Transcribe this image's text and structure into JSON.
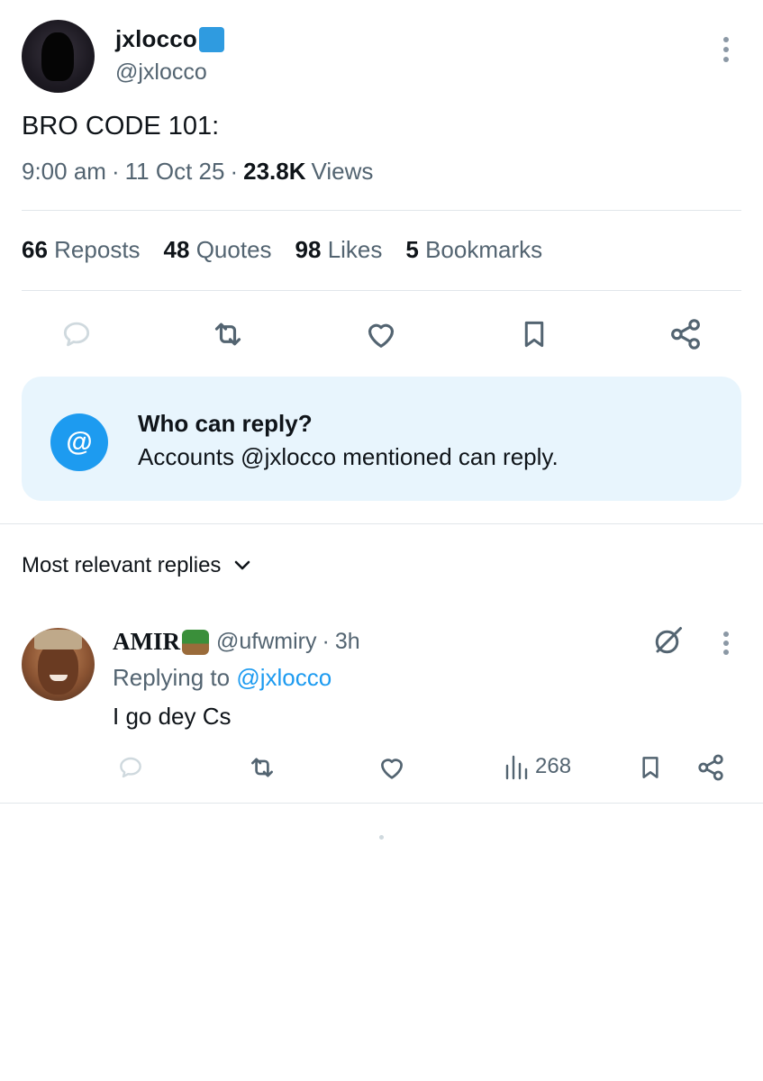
{
  "post": {
    "display_name": "jxlocco",
    "name_emoji": "🏄",
    "handle": "@jxlocco",
    "text": "BRO CODE 101:",
    "time": "9:00 am",
    "date": "11 Oct 25",
    "views_count": "23.8K",
    "views_label": "Views",
    "sep": "·"
  },
  "stats": {
    "reposts_count": "66",
    "reposts_label": "Reposts",
    "quotes_count": "48",
    "quotes_label": "Quotes",
    "likes_count": "98",
    "likes_label": "Likes",
    "bookmarks_count": "5",
    "bookmarks_label": "Bookmarks"
  },
  "reply_notice": {
    "title": "Who can reply?",
    "body": "Accounts @jxlocco mentioned can reply.",
    "icon_glyph": "@"
  },
  "replies_section": {
    "sort_label": "Most relevant replies"
  },
  "reply": {
    "display_name": "AMIR",
    "name_emoji": "🌴",
    "handle": "@ufwmiry",
    "sep": "·",
    "age": "3h",
    "replying_prefix": "Replying to",
    "replying_to": "@jxlocco",
    "text": "I go dey Cs",
    "views_count": "268"
  },
  "colors": {
    "text": "#0f1419",
    "muted": "#536471",
    "accent": "#1d9bf0",
    "notice_bg": "#e8f5fd",
    "divider": "#e1e6ea"
  },
  "icons": [
    "more-icon",
    "reply-icon",
    "repost-icon",
    "like-icon",
    "bookmark-icon",
    "share-icon",
    "at-icon",
    "chevron-down-icon",
    "grok-icon",
    "views-icon"
  ]
}
